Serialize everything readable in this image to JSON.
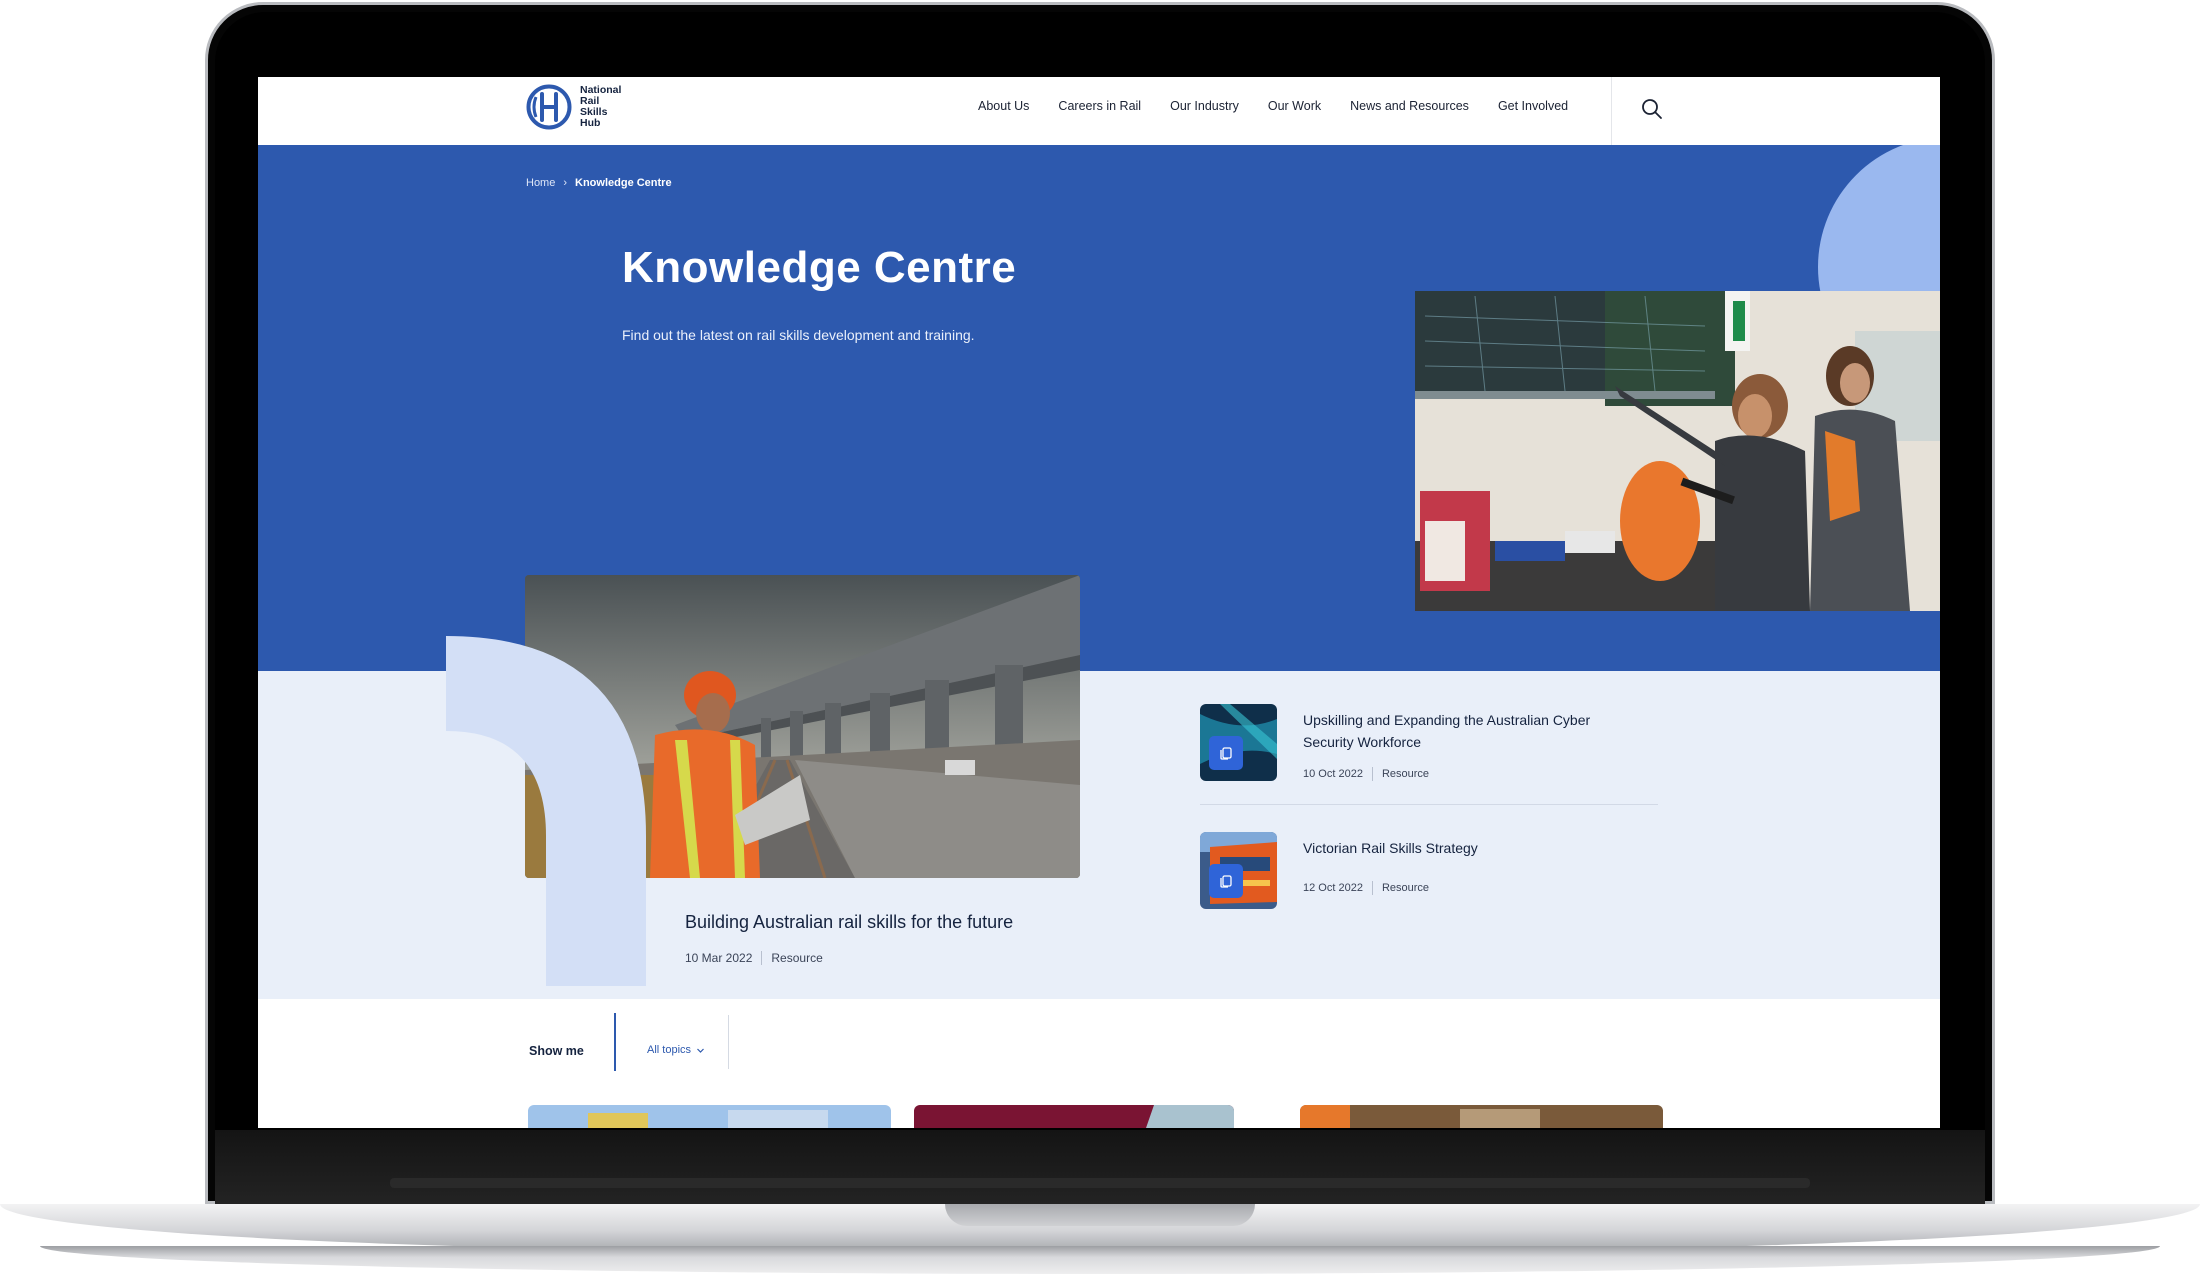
{
  "logo": {
    "lines": [
      "National",
      "Rail",
      "Skills",
      "Hub"
    ]
  },
  "nav": {
    "items": [
      "About Us",
      "Careers in Rail",
      "Our Industry",
      "Our Work",
      "News and Resources",
      "Get Involved"
    ]
  },
  "breadcrumb": {
    "home": "Home",
    "separator": "›",
    "current": "Knowledge Centre"
  },
  "hero": {
    "title": "Knowledge Centre",
    "subtitle": "Find out the latest on rail skills development and training."
  },
  "featured": {
    "title": "Building Australian rail skills for the future",
    "date": "10 Mar 2022",
    "type": "Resource"
  },
  "articles": [
    {
      "title": "Upskilling and Expanding the Australian Cyber Security Workforce",
      "date": "10 Oct 2022",
      "type": "Resource"
    },
    {
      "title": "Victorian Rail Skills Strategy",
      "date": "12 Oct 2022",
      "type": "Resource"
    }
  ],
  "filter": {
    "label": "Show me",
    "topic": "All topics"
  },
  "colors": {
    "brand_blue": "#2d59ae",
    "light_band": "#e9eff9",
    "accent_light": "#9ab8ef",
    "arch": "#d3dff6",
    "badge_blue": "#2f64d8"
  }
}
